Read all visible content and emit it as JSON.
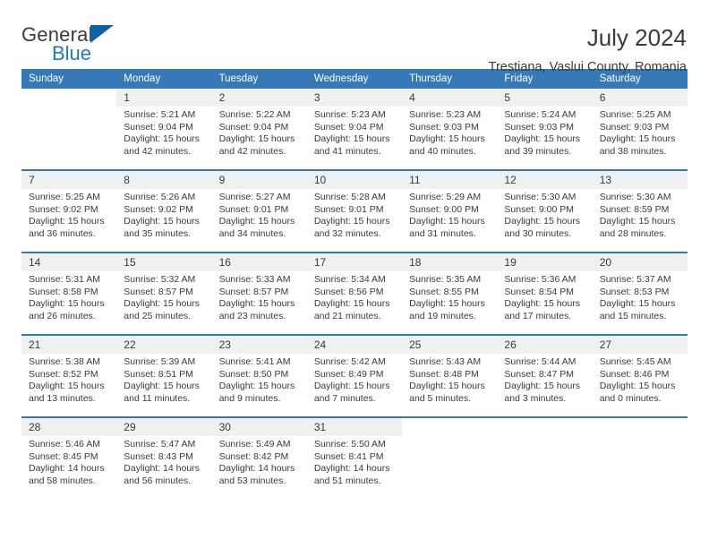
{
  "brand": {
    "name_top": "General",
    "name_bottom": "Blue",
    "accent_color": "#1f7bc1",
    "triangle_color": "#1060a8"
  },
  "header": {
    "title": "July 2024",
    "subtitle": "Trestiana, Vaslui County, Romania"
  },
  "calendar": {
    "header_bg": "#3579b8",
    "daynum_bg": "#f0f0f0",
    "weekdays": [
      "Sunday",
      "Monday",
      "Tuesday",
      "Wednesday",
      "Thursday",
      "Friday",
      "Saturday"
    ],
    "weeks": [
      [
        {
          "day": "",
          "sunrise": "",
          "sunset": "",
          "daylight_1": "",
          "daylight_2": ""
        },
        {
          "day": "1",
          "sunrise": "Sunrise: 5:21 AM",
          "sunset": "Sunset: 9:04 PM",
          "daylight_1": "Daylight: 15 hours",
          "daylight_2": "and 42 minutes."
        },
        {
          "day": "2",
          "sunrise": "Sunrise: 5:22 AM",
          "sunset": "Sunset: 9:04 PM",
          "daylight_1": "Daylight: 15 hours",
          "daylight_2": "and 42 minutes."
        },
        {
          "day": "3",
          "sunrise": "Sunrise: 5:23 AM",
          "sunset": "Sunset: 9:04 PM",
          "daylight_1": "Daylight: 15 hours",
          "daylight_2": "and 41 minutes."
        },
        {
          "day": "4",
          "sunrise": "Sunrise: 5:23 AM",
          "sunset": "Sunset: 9:03 PM",
          "daylight_1": "Daylight: 15 hours",
          "daylight_2": "and 40 minutes."
        },
        {
          "day": "5",
          "sunrise": "Sunrise: 5:24 AM",
          "sunset": "Sunset: 9:03 PM",
          "daylight_1": "Daylight: 15 hours",
          "daylight_2": "and 39 minutes."
        },
        {
          "day": "6",
          "sunrise": "Sunrise: 5:25 AM",
          "sunset": "Sunset: 9:03 PM",
          "daylight_1": "Daylight: 15 hours",
          "daylight_2": "and 38 minutes."
        }
      ],
      [
        {
          "day": "7",
          "sunrise": "Sunrise: 5:25 AM",
          "sunset": "Sunset: 9:02 PM",
          "daylight_1": "Daylight: 15 hours",
          "daylight_2": "and 36 minutes."
        },
        {
          "day": "8",
          "sunrise": "Sunrise: 5:26 AM",
          "sunset": "Sunset: 9:02 PM",
          "daylight_1": "Daylight: 15 hours",
          "daylight_2": "and 35 minutes."
        },
        {
          "day": "9",
          "sunrise": "Sunrise: 5:27 AM",
          "sunset": "Sunset: 9:01 PM",
          "daylight_1": "Daylight: 15 hours",
          "daylight_2": "and 34 minutes."
        },
        {
          "day": "10",
          "sunrise": "Sunrise: 5:28 AM",
          "sunset": "Sunset: 9:01 PM",
          "daylight_1": "Daylight: 15 hours",
          "daylight_2": "and 32 minutes."
        },
        {
          "day": "11",
          "sunrise": "Sunrise: 5:29 AM",
          "sunset": "Sunset: 9:00 PM",
          "daylight_1": "Daylight: 15 hours",
          "daylight_2": "and 31 minutes."
        },
        {
          "day": "12",
          "sunrise": "Sunrise: 5:30 AM",
          "sunset": "Sunset: 9:00 PM",
          "daylight_1": "Daylight: 15 hours",
          "daylight_2": "and 30 minutes."
        },
        {
          "day": "13",
          "sunrise": "Sunrise: 5:30 AM",
          "sunset": "Sunset: 8:59 PM",
          "daylight_1": "Daylight: 15 hours",
          "daylight_2": "and 28 minutes."
        }
      ],
      [
        {
          "day": "14",
          "sunrise": "Sunrise: 5:31 AM",
          "sunset": "Sunset: 8:58 PM",
          "daylight_1": "Daylight: 15 hours",
          "daylight_2": "and 26 minutes."
        },
        {
          "day": "15",
          "sunrise": "Sunrise: 5:32 AM",
          "sunset": "Sunset: 8:57 PM",
          "daylight_1": "Daylight: 15 hours",
          "daylight_2": "and 25 minutes."
        },
        {
          "day": "16",
          "sunrise": "Sunrise: 5:33 AM",
          "sunset": "Sunset: 8:57 PM",
          "daylight_1": "Daylight: 15 hours",
          "daylight_2": "and 23 minutes."
        },
        {
          "day": "17",
          "sunrise": "Sunrise: 5:34 AM",
          "sunset": "Sunset: 8:56 PM",
          "daylight_1": "Daylight: 15 hours",
          "daylight_2": "and 21 minutes."
        },
        {
          "day": "18",
          "sunrise": "Sunrise: 5:35 AM",
          "sunset": "Sunset: 8:55 PM",
          "daylight_1": "Daylight: 15 hours",
          "daylight_2": "and 19 minutes."
        },
        {
          "day": "19",
          "sunrise": "Sunrise: 5:36 AM",
          "sunset": "Sunset: 8:54 PM",
          "daylight_1": "Daylight: 15 hours",
          "daylight_2": "and 17 minutes."
        },
        {
          "day": "20",
          "sunrise": "Sunrise: 5:37 AM",
          "sunset": "Sunset: 8:53 PM",
          "daylight_1": "Daylight: 15 hours",
          "daylight_2": "and 15 minutes."
        }
      ],
      [
        {
          "day": "21",
          "sunrise": "Sunrise: 5:38 AM",
          "sunset": "Sunset: 8:52 PM",
          "daylight_1": "Daylight: 15 hours",
          "daylight_2": "and 13 minutes."
        },
        {
          "day": "22",
          "sunrise": "Sunrise: 5:39 AM",
          "sunset": "Sunset: 8:51 PM",
          "daylight_1": "Daylight: 15 hours",
          "daylight_2": "and 11 minutes."
        },
        {
          "day": "23",
          "sunrise": "Sunrise: 5:41 AM",
          "sunset": "Sunset: 8:50 PM",
          "daylight_1": "Daylight: 15 hours",
          "daylight_2": "and 9 minutes."
        },
        {
          "day": "24",
          "sunrise": "Sunrise: 5:42 AM",
          "sunset": "Sunset: 8:49 PM",
          "daylight_1": "Daylight: 15 hours",
          "daylight_2": "and 7 minutes."
        },
        {
          "day": "25",
          "sunrise": "Sunrise: 5:43 AM",
          "sunset": "Sunset: 8:48 PM",
          "daylight_1": "Daylight: 15 hours",
          "daylight_2": "and 5 minutes."
        },
        {
          "day": "26",
          "sunrise": "Sunrise: 5:44 AM",
          "sunset": "Sunset: 8:47 PM",
          "daylight_1": "Daylight: 15 hours",
          "daylight_2": "and 3 minutes."
        },
        {
          "day": "27",
          "sunrise": "Sunrise: 5:45 AM",
          "sunset": "Sunset: 8:46 PM",
          "daylight_1": "Daylight: 15 hours",
          "daylight_2": "and 0 minutes."
        }
      ],
      [
        {
          "day": "28",
          "sunrise": "Sunrise: 5:46 AM",
          "sunset": "Sunset: 8:45 PM",
          "daylight_1": "Daylight: 14 hours",
          "daylight_2": "and 58 minutes."
        },
        {
          "day": "29",
          "sunrise": "Sunrise: 5:47 AM",
          "sunset": "Sunset: 8:43 PM",
          "daylight_1": "Daylight: 14 hours",
          "daylight_2": "and 56 minutes."
        },
        {
          "day": "30",
          "sunrise": "Sunrise: 5:49 AM",
          "sunset": "Sunset: 8:42 PM",
          "daylight_1": "Daylight: 14 hours",
          "daylight_2": "and 53 minutes."
        },
        {
          "day": "31",
          "sunrise": "Sunrise: 5:50 AM",
          "sunset": "Sunset: 8:41 PM",
          "daylight_1": "Daylight: 14 hours",
          "daylight_2": "and 51 minutes."
        },
        {
          "day": "",
          "sunrise": "",
          "sunset": "",
          "daylight_1": "",
          "daylight_2": ""
        },
        {
          "day": "",
          "sunrise": "",
          "sunset": "",
          "daylight_1": "",
          "daylight_2": ""
        },
        {
          "day": "",
          "sunrise": "",
          "sunset": "",
          "daylight_1": "",
          "daylight_2": ""
        }
      ]
    ]
  }
}
